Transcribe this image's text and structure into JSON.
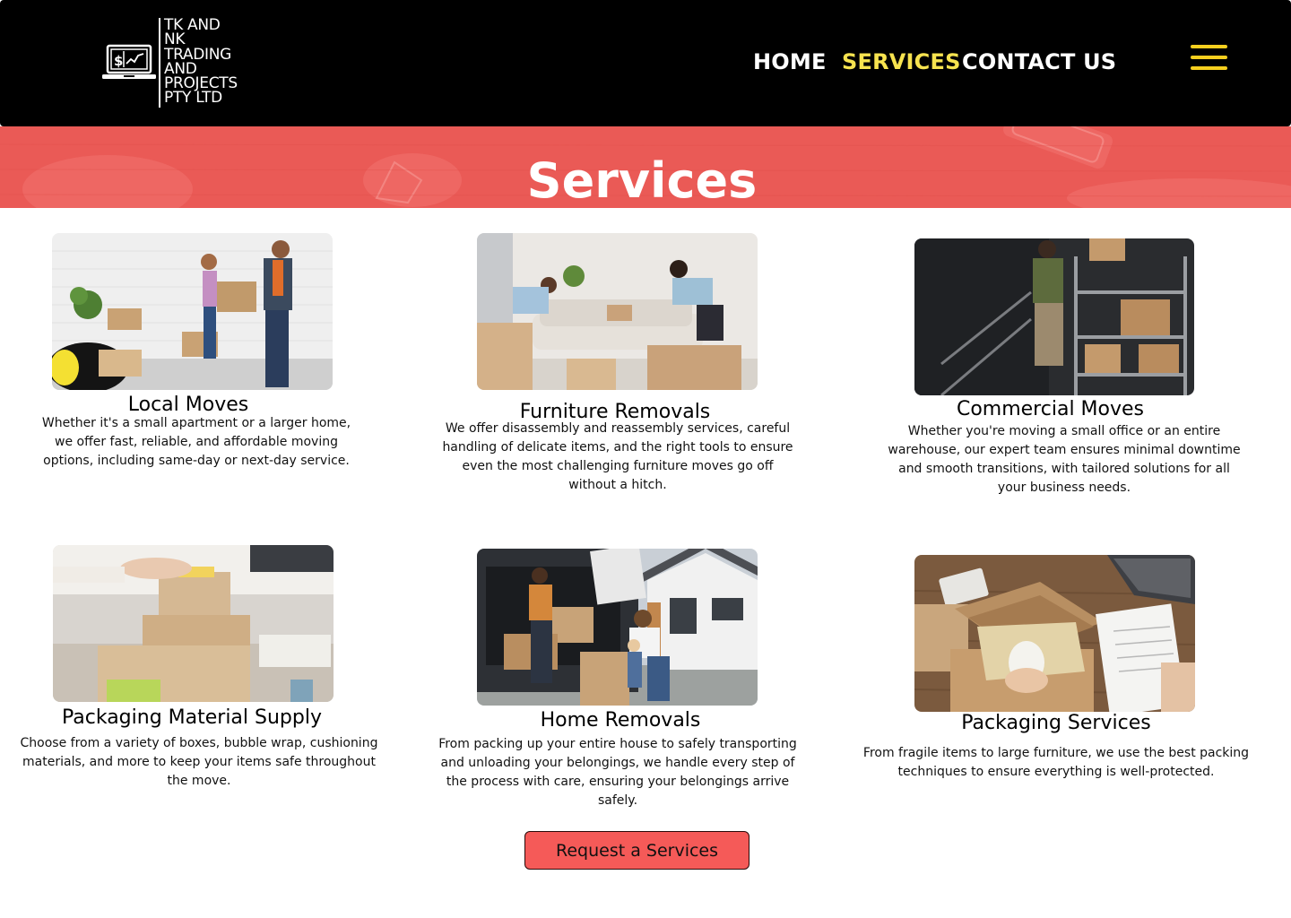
{
  "brand": {
    "lines": [
      "TK AND",
      "NK",
      "TRADING",
      "AND",
      "PROJECTS",
      "PTY LTD"
    ],
    "icon": "laptop-dollar-chart-icon"
  },
  "nav": {
    "items": [
      {
        "label": "HOME",
        "active": false
      },
      {
        "label": "SERVICES",
        "active": true
      },
      {
        "label": "CONTACT US",
        "active": false
      }
    ],
    "menu_icon": "hamburger-menu-icon",
    "active_color": "#f7e34f",
    "menu_color": "#f7cf1e"
  },
  "banner": {
    "title": "Services",
    "color": "#ea5a56"
  },
  "services": [
    {
      "title": "Local Moves",
      "description": "Whether it's a small apartment or a larger home, we offer fast, reliable, and affordable moving options, including same-day or next-day service.",
      "image": "couple-carrying-boxes-photo"
    },
    {
      "title": "Furniture Removals",
      "description": "We offer disassembly and reassembly services, careful handling of delicate items, and the right tools to ensure even the most challenging furniture moves go off without a hitch.",
      "image": "people-lifting-sofa-photo"
    },
    {
      "title": "Commercial Moves",
      "description": "Whether you're moving a small office or an entire warehouse, our expert team ensures minimal downtime and smooth transitions, with tailored solutions for all your business needs.",
      "image": "worker-stacking-shelves-photo"
    },
    {
      "title": "Packaging Material Supply",
      "description": "Choose from a variety of boxes, bubble wrap, cushioning materials, and more to keep your items safe throughout the move.",
      "image": "taping-cardboard-boxes-photo"
    },
    {
      "title": "Home Removals",
      "description": "From packing up your entire house to safely transporting and unloading your belongings, we handle every step of the process with care, ensuring your belongings arrive safely.",
      "image": "family-loading-van-photo"
    },
    {
      "title": "Packaging Services",
      "description": "From fragile items to large furniture, we use the best packing techniques to ensure everything is well-protected.",
      "image": "packing-mug-in-box-photo"
    }
  ],
  "cta": {
    "label": "Request a Services",
    "color": "#f55a58"
  }
}
